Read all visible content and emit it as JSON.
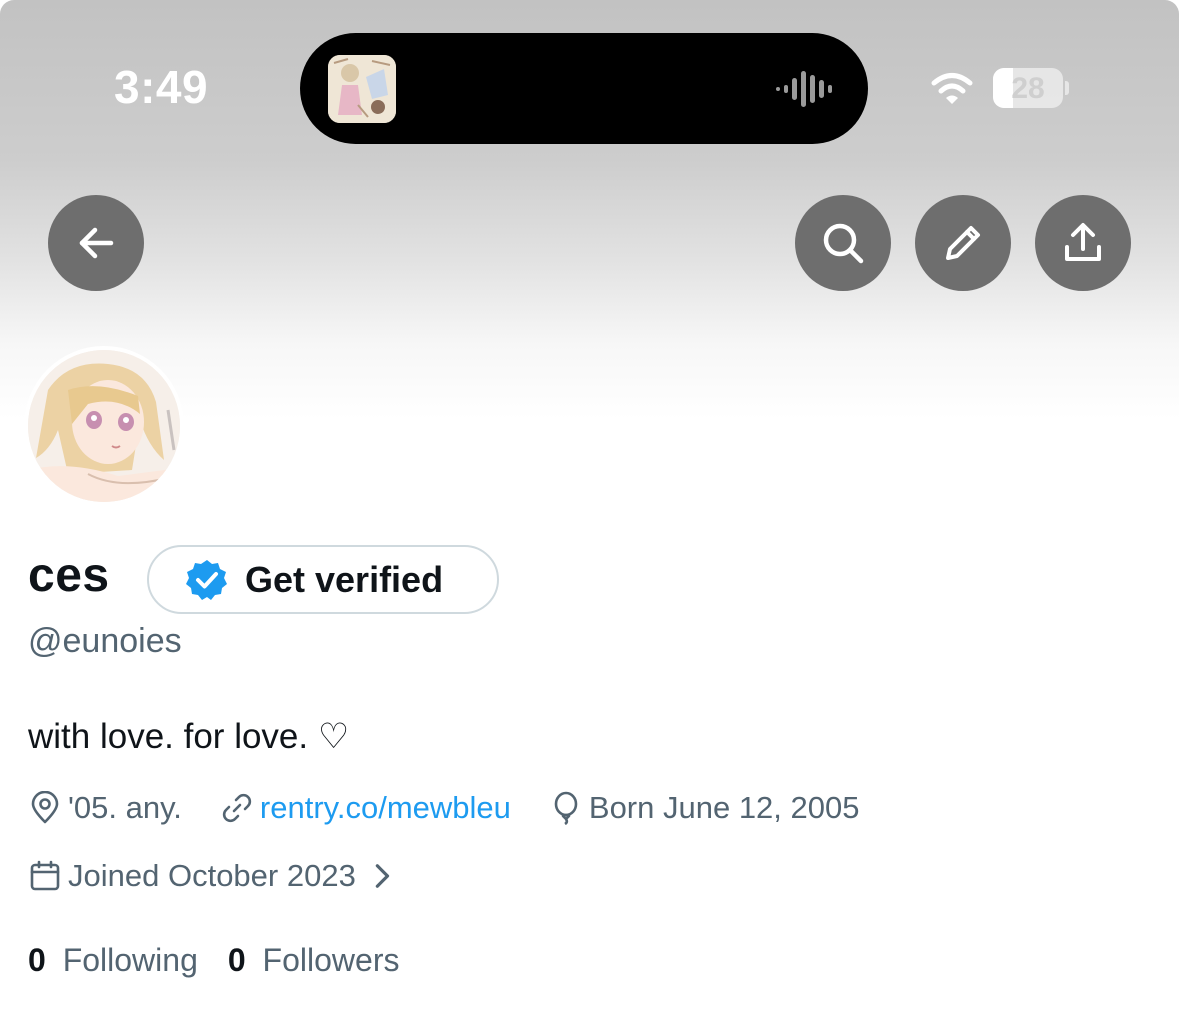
{
  "status_bar": {
    "time": "3:49",
    "battery_level": "28",
    "battery_fraction": 0.28,
    "icons": [
      "wifi-icon",
      "battery-icon",
      "audio-waveform-icon"
    ]
  },
  "header": {
    "buttons": [
      "back-arrow-icon",
      "search-icon",
      "pencil-icon",
      "share-upload-icon"
    ]
  },
  "profile": {
    "display_name": "ces",
    "verify_label": "Get verified",
    "handle": "@eunoies",
    "bio": "with love. for love. ♡",
    "location": "'05. any.",
    "website": "rentry.co/mewbleu",
    "birthday": "Born June 12, 2005",
    "joined": "Joined October 2023",
    "following_count": "0",
    "following_label": "Following",
    "followers_count": "0",
    "followers_label": "Followers"
  },
  "colors": {
    "link": "#1d9bf0",
    "secondary_text": "#536471",
    "primary_text": "#0f1419",
    "header_button_bg": "#6e6e6e",
    "verified_badge": "#1d9bf0"
  }
}
